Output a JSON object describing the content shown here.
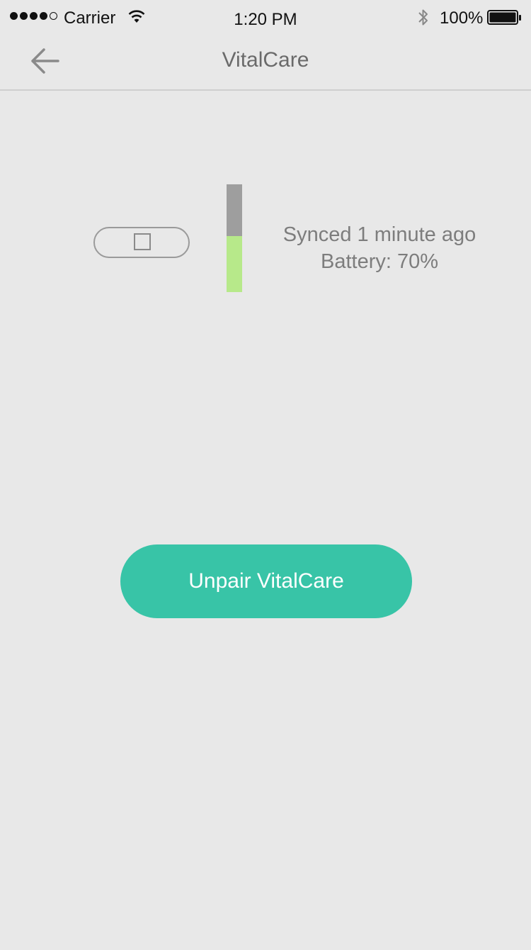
{
  "status_bar": {
    "carrier": "Carrier",
    "time": "1:20 PM",
    "battery_percent": "100%",
    "signal_bars_filled": 4,
    "signal_bars_total": 5,
    "icons": [
      "wifi-icon",
      "bluetooth-icon",
      "battery-icon"
    ]
  },
  "nav": {
    "title": "VitalCare",
    "back_icon": "arrow-left-icon"
  },
  "device": {
    "icon": "wearable-band-icon",
    "battery_level": 0.7,
    "sync_text": "Synced 1 minute ago",
    "battery_text": "Battery: 70%"
  },
  "actions": {
    "unpair_label": "Unpair VitalCare"
  },
  "colors": {
    "background": "#e8e8e8",
    "accent": "#38c4a7",
    "battery_fill": "#b7e98a",
    "battery_empty": "#9e9e9e",
    "text_muted": "#7d7d7d"
  }
}
